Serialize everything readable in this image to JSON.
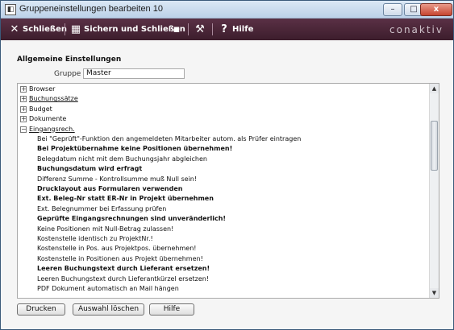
{
  "window": {
    "title": "Gruppeneinstellungen bearbeiten 10",
    "minimize_glyph": "–",
    "maximize_glyph": "□",
    "close_glyph": "x"
  },
  "toolbar": {
    "close_label": "Schließen",
    "save_close_label": "Sichern und Schließen",
    "help_label": "Hilfe",
    "brand": "conaktiv"
  },
  "settings": {
    "section_title": "Allgemeine Einstellungen",
    "group_label": "Gruppe",
    "group_value": "Master"
  },
  "tree": {
    "categories": [
      {
        "label": "Browser",
        "expander": "+"
      },
      {
        "label": "Buchungssätze",
        "expander": "+"
      },
      {
        "label": "Budget",
        "expander": "+"
      },
      {
        "label": "Dokumente",
        "expander": "+"
      },
      {
        "label": "Eingangsrech.",
        "expander": "−"
      }
    ],
    "items": [
      {
        "label": "Bei \"Geprüft\"-Funktion den angemeldeten Mitarbeiter autom. als Prüfer eintragen",
        "bold": false
      },
      {
        "label": "Bei Projektübernahme keine Positionen übernehmen!",
        "bold": true
      },
      {
        "label": "Belegdatum nicht mit dem Buchungsjahr abgleichen",
        "bold": false
      },
      {
        "label": "Buchungsdatum wird erfragt",
        "bold": true
      },
      {
        "label": "Differenz Summe - Kontrollsumme muß Null sein!",
        "bold": false
      },
      {
        "label": "Drucklayout aus Formularen verwenden",
        "bold": true
      },
      {
        "label": "Ext. Beleg-Nr statt ER-Nr in Projekt übernehmen",
        "bold": true
      },
      {
        "label": "Ext. Belegnummer bei Erfassung prüfen",
        "bold": false
      },
      {
        "label": "Geprüfte Eingangsrechnungen sind unveränderlich!",
        "bold": true
      },
      {
        "label": "Keine Positionen mit Null-Betrag zulassen!",
        "bold": false
      },
      {
        "label": "Kostenstelle identisch zu ProjektNr.!",
        "bold": false
      },
      {
        "label": "Kostenstelle in Pos. aus Projektpos. übernehmen!",
        "bold": false
      },
      {
        "label": "Kostenstelle in Positionen aus Projekt übernehmen!",
        "bold": false
      },
      {
        "label": "Leeren Buchungstext durch Lieferant ersetzen!",
        "bold": true
      },
      {
        "label": "Leeren Buchungstext durch Lieferantkürzel ersetzen!",
        "bold": false
      },
      {
        "label": "PDF Dokument automatisch an Mail hängen",
        "bold": false
      }
    ],
    "scroll_up": "▲",
    "scroll_down": "▼"
  },
  "buttons": {
    "print": "Drucken",
    "clear_selection": "Auswahl löschen",
    "help": "Hilfe"
  },
  "icons": {
    "close": "close-x-icon",
    "save_close": "save-close-icon",
    "disk": "floppy-disk-icon",
    "tools": "wrench-icon",
    "help": "question-mark-icon"
  }
}
